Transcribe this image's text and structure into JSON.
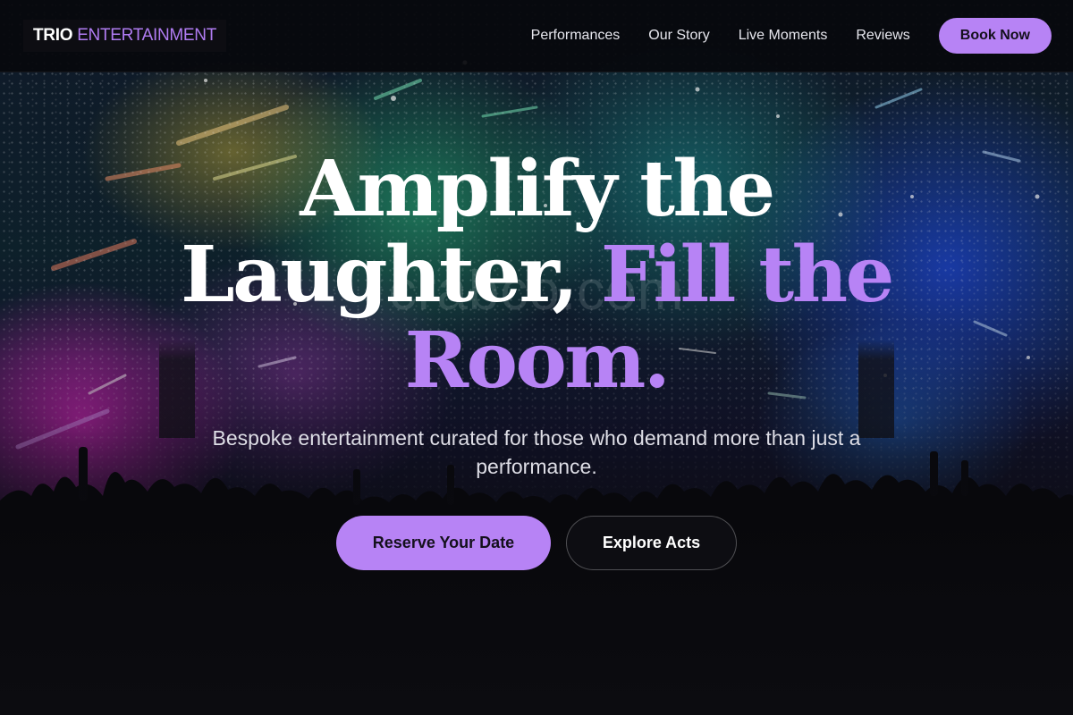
{
  "brand": {
    "primary": "TRIO",
    "accent": "ENTERTAINMENT"
  },
  "nav": {
    "items": [
      {
        "label": "Performances"
      },
      {
        "label": "Our Story"
      },
      {
        "label": "Live Moments"
      },
      {
        "label": "Reviews"
      }
    ],
    "cta_label": "Book Now"
  },
  "hero": {
    "title_line1": "Amplify the",
    "title_line2_white": "Laughter,",
    "title_line2_accent": "Fill the",
    "title_line3_accent": "Room.",
    "subtitle": "Bespoke entertainment curated for those who demand more than just a performance.",
    "primary_button": "Reserve Your Date",
    "secondary_button": "Explore Acts",
    "watermark": "crabco.com"
  },
  "colors": {
    "accent": "#b783f5",
    "nav_background": "#06080c",
    "text": "#ffffff"
  }
}
